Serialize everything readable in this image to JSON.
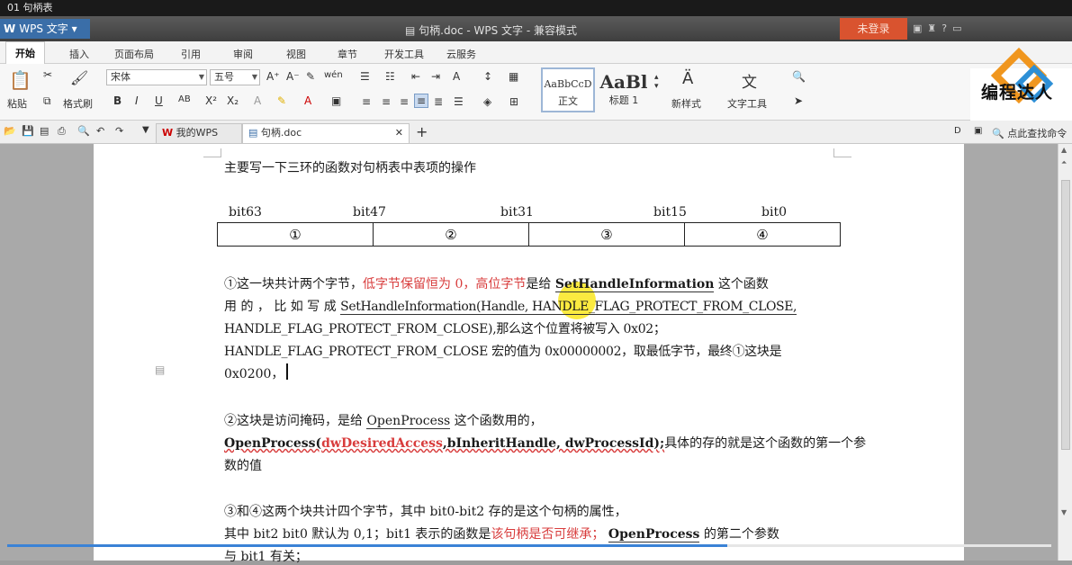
{
  "video": {
    "title": "01 句柄表"
  },
  "titlebar": {
    "app_name": "WPS 文字",
    "doc_title": "句柄.doc - WPS 文字 - 兼容模式",
    "login": "未登录"
  },
  "menu": {
    "tabs": [
      "开始",
      "插入",
      "页面布局",
      "引用",
      "审阅",
      "视图",
      "章节",
      "开发工具",
      "云服务"
    ]
  },
  "ribbon": {
    "paste": "粘贴",
    "format_painter": "格式刷",
    "font_name": "宋体",
    "font_size": "五号",
    "style_normal_preview": "AaBbCcD",
    "style_normal": "正文",
    "style_heading_preview": "AaBl",
    "style_heading": "标题 1",
    "new_style": "新样式",
    "text_tools": "文字工具",
    "brand": "编程达人"
  },
  "qabar": {
    "tab_mywps": "我的WPS",
    "tab_doc": "句柄.doc",
    "find_cmd": "点此查找命令"
  },
  "document": {
    "heading": "主要写一下三环的函数对句柄表中表项的操作",
    "bit_labels": [
      "bit63",
      "bit47",
      "bit31",
      "bit15",
      "bit0"
    ],
    "cells": [
      "①",
      "②",
      "③",
      "④"
    ],
    "p1": {
      "l1_a": "①这一块共计两个字节，",
      "l1_red": "低字节保留恒为 0，高位字节",
      "l1_b": "是给 ",
      "l1_fn": "SetHandleInformation",
      "l1_c": " 这个函数",
      "l2_a": "用 的 ， 比 如 写 成 ",
      "l2_b": "SetHandleInformation(Handle, HANDLE_FLAG_PROTECT_FROM_CLOSE,",
      "l3": "HANDLE_FLAG_PROTECT_FROM_CLOSE),那么这个位置将被写入 0x02；",
      "l4": "HANDLE_FLAG_PROTECT_FROM_CLOSE 宏的值为 0x00000002，取最低字节，最终①这块是",
      "l5": "0x0200，"
    },
    "p2": {
      "l1_a": "②这块是访问掩码，是给 ",
      "l1_fn": "OpenProcess",
      "l1_b": " 这个函数用的，",
      "l2_fn": "OpenProcess(",
      "l2_p1": "dwDesiredAccess",
      "l2_p2": ",bInheritHandle, dwProcessId);",
      "l2_rest": "具体的存的就是这个函数的第一个参",
      "l3": "数的值"
    },
    "p3": {
      "l1": "③和④这两个块共计四个字节，其中 bit0-bit2 存的是这个句柄的属性，",
      "l2_a": "其中 bit2 bit0 默认为 0,1；bit1 表示的函数是",
      "l2_red": "该句柄是否可继承；",
      "l2_fn": "OpenProcess",
      "l2_b": " 的第二个参数",
      "l3": "与 bit1 有关；"
    }
  },
  "progress": {
    "fraction": 0.69
  }
}
